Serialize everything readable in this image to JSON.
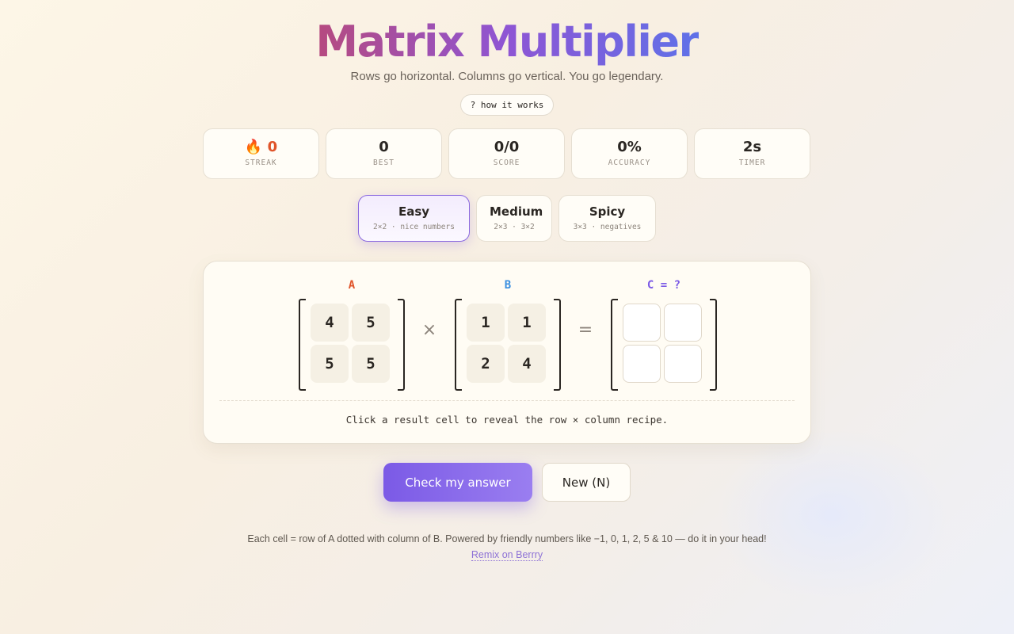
{
  "header": {
    "title": "Matrix Multiplier",
    "subtitle": "Rows go horizontal. Columns go vertical. You go legendary.",
    "how_button": "? how it works"
  },
  "stats": [
    {
      "icon": "🔥",
      "value": "0",
      "label": "STREAK",
      "color": "#e0542a"
    },
    {
      "value": "0",
      "label": "BEST"
    },
    {
      "value": "0/0",
      "label": "SCORE"
    },
    {
      "value": "0%",
      "label": "ACCURACY"
    },
    {
      "value": "2s",
      "label": "TIMER"
    }
  ],
  "levels": [
    {
      "name": "Easy",
      "desc": "2×2 · nice numbers",
      "selected": true
    },
    {
      "name": "Medium",
      "desc": "2×3 · 3×2",
      "selected": false
    },
    {
      "name": "Spicy",
      "desc": "3×3 · negatives",
      "selected": false
    }
  ],
  "board": {
    "matrix_a": {
      "label": "A",
      "color": "#e0542a",
      "cells": [
        "4",
        "5",
        "5",
        "5"
      ]
    },
    "times_symbol": "×",
    "matrix_b": {
      "label": "B",
      "color": "#3a8fe0",
      "cells": [
        "1",
        "1",
        "2",
        "4"
      ]
    },
    "equals_symbol": "=",
    "matrix_c": {
      "label": "C = ?",
      "color": "#7b5ae6",
      "cells": [
        "",
        "",
        "",
        ""
      ]
    },
    "hint": "Click a result cell to reveal the row × column recipe."
  },
  "actions": {
    "check_label": "Check my answer",
    "new_label": "New (N)"
  },
  "footer": {
    "text": "Each cell = row of A dotted with column of B. Powered by friendly numbers like −1, 0, 1, 2, 5 & 10 — do it in your head!",
    "link": "Remix on Berrry"
  }
}
